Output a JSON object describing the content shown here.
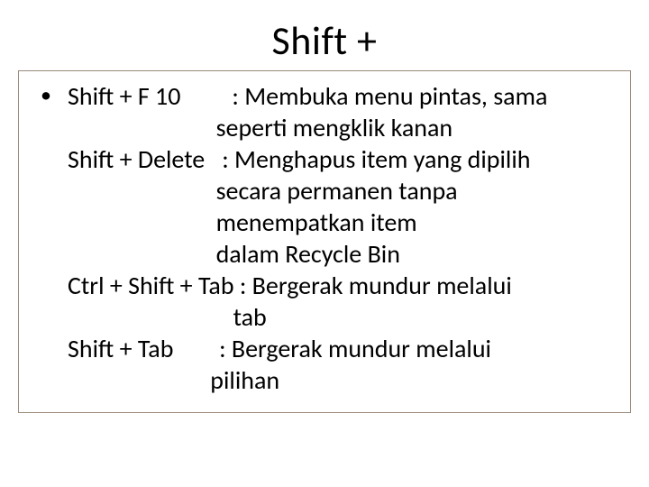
{
  "title": "Shift +",
  "bullet_glyph": "•",
  "lines": {
    "l1": "Shift + F 10         : Membuka menu pintas, sama",
    "l2": "                          seperti mengklik kanan",
    "l3": "Shift + Delete   : Menghapus item yang dipilih",
    "l4": "                          secara permanen tanpa",
    "l5": "                          menempatkan item",
    "l6": "                          dalam Recycle Bin",
    "l7": "Ctrl + Shift + Tab : Bergerak mundur melalui",
    "l8": "                             tab",
    "l9": "Shift + Tab        : Bergerak mundur melalui",
    "l10": "                         pilihan"
  }
}
